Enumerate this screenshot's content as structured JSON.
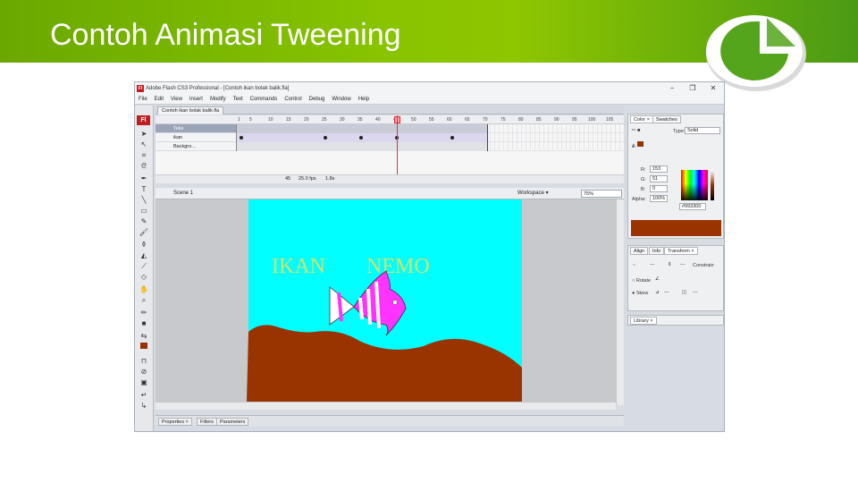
{
  "slide": {
    "title": "Contoh Animasi Tweening",
    "colors": {
      "header_green": "#88c400",
      "logo_green": "#55a51c"
    }
  },
  "app": {
    "badge": "Fl",
    "window_title": "Adobe Flash CS3 Professional - [Contoh ikan bolak balik.fla]",
    "window_buttons": {
      "minimize": "−",
      "restore": "❐",
      "close": "✕"
    },
    "menu": [
      "File",
      "Edit",
      "View",
      "Insert",
      "Modify",
      "Text",
      "Commands",
      "Control",
      "Debug",
      "Window",
      "Help"
    ],
    "doc_tab": "Contoh ikan bolak balik.fla",
    "ruler_numbers": [
      "1",
      "5",
      "10",
      "15",
      "20",
      "25",
      "30",
      "35",
      "40",
      "45",
      "50",
      "55",
      "60",
      "65",
      "70",
      "75",
      "80",
      "85",
      "90",
      "95",
      "100",
      "105"
    ],
    "layers": [
      {
        "name": "Teks",
        "selected": true
      },
      {
        "name": "ikan",
        "selected": false
      },
      {
        "name": "Backgro...",
        "selected": false
      }
    ],
    "timeline_status": {
      "frame": "45",
      "fps": "25.0 fps",
      "time": "1.8s"
    },
    "current_frame": 45,
    "scene": "Scene 1",
    "workspace": "Workspace ▾",
    "zoom": "75%",
    "stage": {
      "background_color": "#00ffff",
      "ground_color": "#993300",
      "text_left": "IKAN",
      "text_right": "NEMO",
      "text_color": "#d4e26a",
      "fish_color": "#ff33ff"
    },
    "bottom_tabs": [
      "Properties ×",
      "Filters",
      "Parameters"
    ]
  },
  "color_panel": {
    "tabs": [
      "Color ×",
      "Swatches"
    ],
    "type_label": "Type:",
    "type_value": "Solid",
    "r_label": "R:",
    "r_value": "153",
    "g_label": "G:",
    "g_value": "51",
    "b_label": "B:",
    "b_value": "0",
    "alpha_label": "Alpha:",
    "alpha_value": "100%",
    "hex": "#993300",
    "current_color": "#993300"
  },
  "transform_panel": {
    "tabs": [
      "Align",
      "Info",
      "Transform ×"
    ],
    "field_placeholder": "---",
    "constrain": "Constrain",
    "rotate": "Rotate",
    "skew": "Skew"
  },
  "library_panel": {
    "tabs": [
      "Library ×"
    ]
  }
}
